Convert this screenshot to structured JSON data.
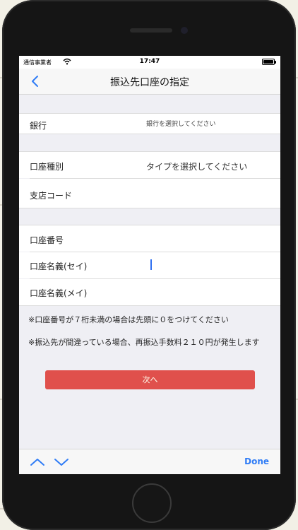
{
  "status_bar": {
    "carrier": "通信事業者",
    "time": "17:47"
  },
  "nav": {
    "title": "振込先口座の指定",
    "back_icon": "chevron-left-icon"
  },
  "bank_row": {
    "label": "銀行",
    "value": "銀行を選択してください"
  },
  "account_type_row": {
    "label": "口座種別",
    "value": "タイプを選択してください"
  },
  "branch_row": {
    "label": "支店コード",
    "value": ""
  },
  "account_number_row": {
    "label": "口座番号",
    "value": ""
  },
  "name_kana_sei_row": {
    "label": "口座名義(セイ)",
    "value": ""
  },
  "name_kana_mei_row": {
    "label": "口座名義(メイ)",
    "value": ""
  },
  "notes": [
    "※口座番号が７桁未満の場合は先頭に０をつけてください",
    "※振込先が間違っている場合、再振込手数料２１０円が発生します"
  ],
  "next_button": {
    "label": "次へ",
    "color": "#e0504c"
  },
  "toolbar": {
    "done_label": "Done",
    "up_icon": "chevron-up-icon",
    "down_icon": "chevron-down-icon"
  },
  "colors": {
    "accent": "#2f7cf6",
    "background": "#efeff4",
    "phone_body": "#151515"
  }
}
